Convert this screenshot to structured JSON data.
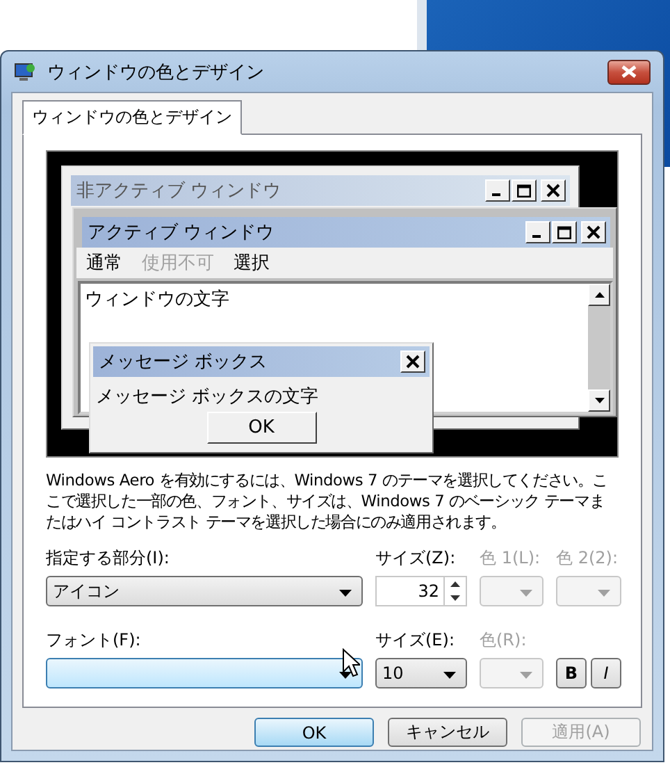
{
  "window": {
    "title": "ウィンドウの色とデザイン"
  },
  "tabs": [
    {
      "label": "ウィンドウの色とデザイン",
      "selected": true
    }
  ],
  "preview": {
    "inactive_window": {
      "title": "非アクティブ ウィンドウ"
    },
    "active_window": {
      "title": "アクティブ ウィンドウ",
      "menu": [
        {
          "label": "通常",
          "disabled": false
        },
        {
          "label": "使用不可",
          "disabled": true
        },
        {
          "label": "選択",
          "disabled": false
        }
      ],
      "text": "ウィンドウの文字"
    },
    "message_box": {
      "title": "メッセージ ボックス",
      "text": "メッセージ ボックスの文字",
      "button": "OK"
    }
  },
  "description": "Windows Aero を有効にするには、Windows 7 のテーマを選択してください。ここで選択した一部の色、フォント、サイズは、Windows 7  のベーシック テーマまたはハイ コントラスト テーマを選択した場合にのみ適用されます。",
  "item": {
    "label": "指定する部分(I):",
    "value": "アイコン"
  },
  "item_size": {
    "label": "サイズ(Z):",
    "value": "32"
  },
  "color1": {
    "label": "色 1(L):",
    "disabled": true
  },
  "color2": {
    "label": "色 2(2):",
    "disabled": true
  },
  "font": {
    "label": "フォント(F):",
    "hovered": true
  },
  "font_size": {
    "label": "サイズ(E):",
    "value": "10"
  },
  "font_color": {
    "label": "色(R):",
    "disabled": true
  },
  "style_buttons": [
    {
      "label": "B",
      "kind": "bold"
    },
    {
      "label": "I",
      "kind": "italic"
    }
  ],
  "buttons": [
    {
      "label": "OK",
      "kind": "default",
      "disabled": false
    },
    {
      "label": "キャンセル",
      "kind": "normal",
      "disabled": false
    },
    {
      "label": "適用(A)",
      "kind": "normal",
      "disabled": true
    }
  ]
}
